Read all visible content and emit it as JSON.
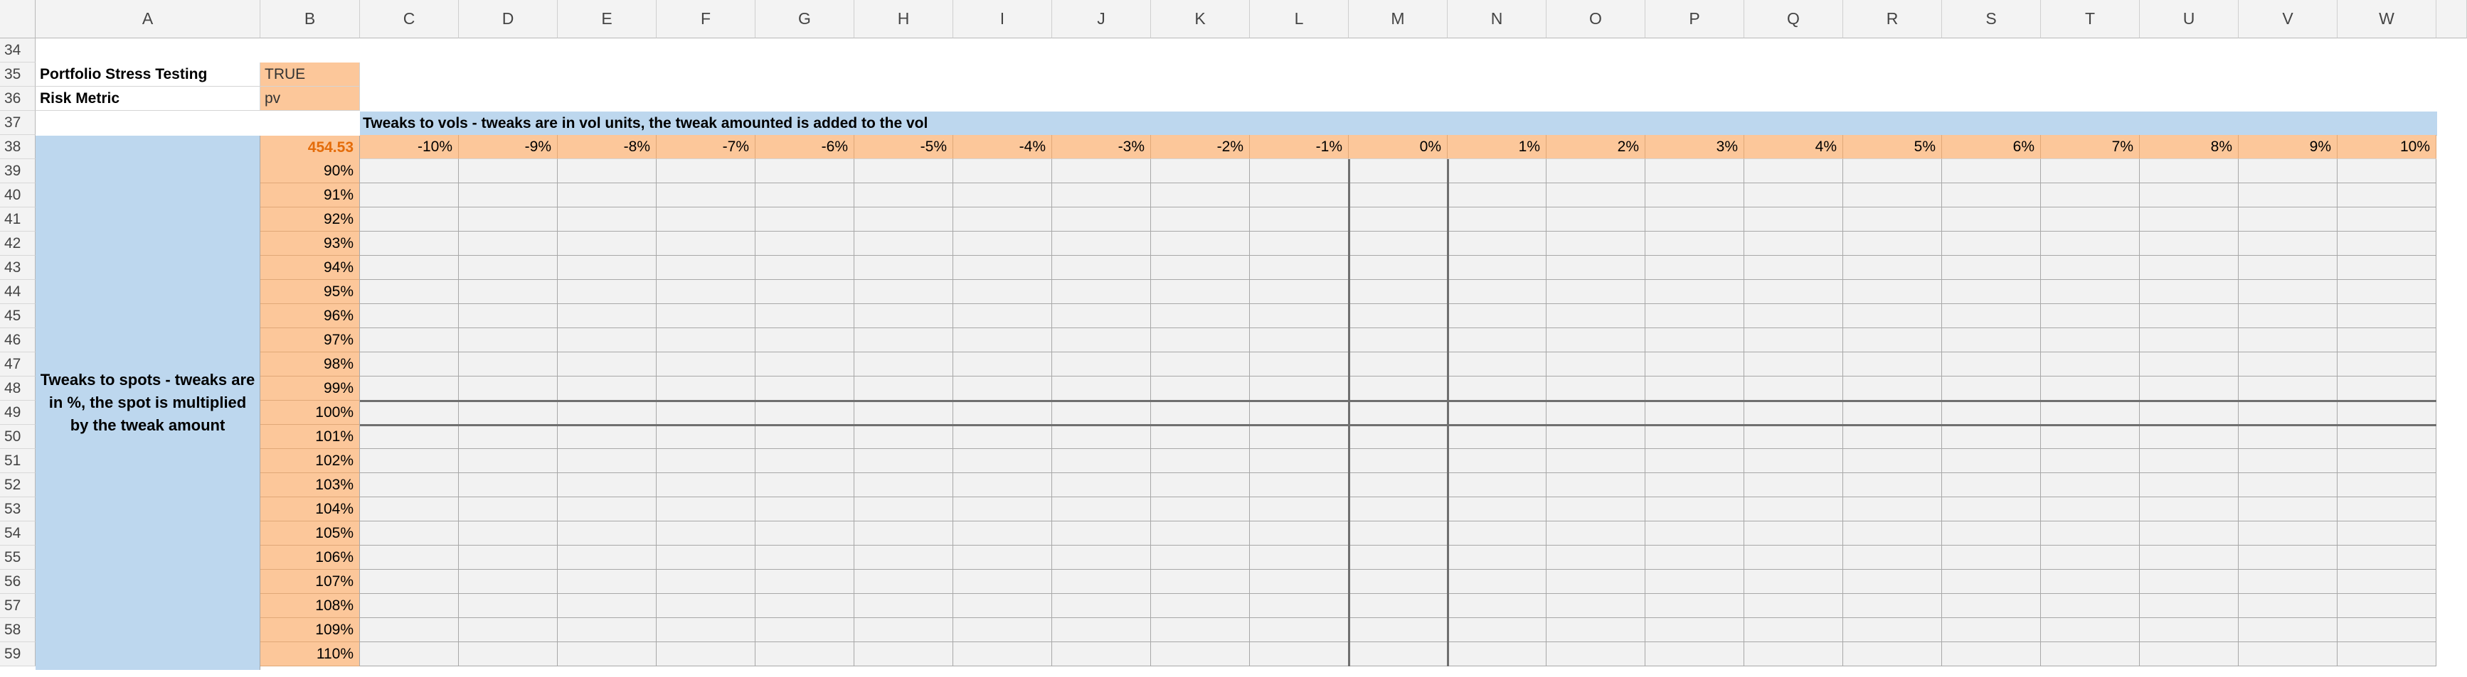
{
  "columns": [
    "A",
    "B",
    "C",
    "D",
    "E",
    "F",
    "G",
    "H",
    "I",
    "J",
    "K",
    "L",
    "M",
    "N",
    "O",
    "P",
    "Q",
    "R",
    "S",
    "T",
    "U",
    "V",
    "W"
  ],
  "rows": [
    "34",
    "35",
    "36",
    "37",
    "38",
    "39",
    "40",
    "41",
    "42",
    "43",
    "44",
    "45",
    "46",
    "47",
    "48",
    "49",
    "50",
    "51",
    "52",
    "53",
    "54",
    "55",
    "56",
    "57",
    "58",
    "59"
  ],
  "settings": {
    "stress_label": "Portfolio Stress Testing",
    "stress_value": "TRUE",
    "metric_label": "Risk Metric",
    "metric_value": "pv"
  },
  "vol_title": "Tweaks to vols - tweaks are in vol units, the tweak amounted is added to the vol",
  "spot_label": "Tweaks to spots - tweaks are in %, the spot is multiplied by the tweak amount",
  "base_value": "454.53",
  "vol_tweaks": [
    "-10%",
    "-9%",
    "-8%",
    "-7%",
    "-6%",
    "-5%",
    "-4%",
    "-3%",
    "-2%",
    "-1%",
    "0%",
    "1%",
    "2%",
    "3%",
    "4%",
    "5%",
    "6%",
    "7%",
    "8%",
    "9%",
    "10%"
  ],
  "spot_tweaks": [
    "90%",
    "91%",
    "92%",
    "93%",
    "94%",
    "95%",
    "96%",
    "97%",
    "98%",
    "99%",
    "100%",
    "101%",
    "102%",
    "103%",
    "104%",
    "105%",
    "106%",
    "107%",
    "108%",
    "109%",
    "110%"
  ],
  "colors": {
    "orange_fill": "#fcc79a",
    "blue_fill": "#bdd7ee",
    "grid_fill": "#f2f2f2",
    "base_value_text": "#e46c0a"
  }
}
